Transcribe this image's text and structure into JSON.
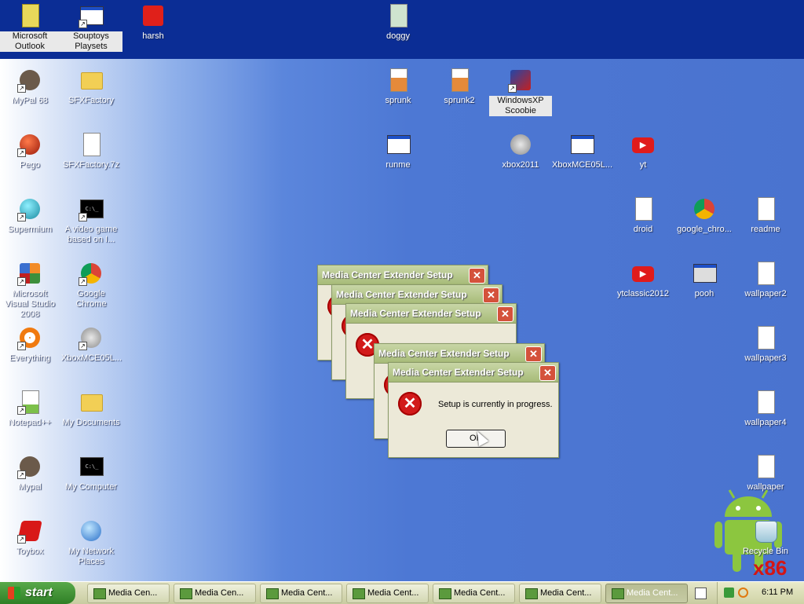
{
  "desktop_icons": [
    {
      "label": "Microsoft Outlook",
      "icon": "outlook-icon"
    },
    {
      "label": "Souptoys Playsets",
      "icon": "app-window-icon"
    },
    {
      "label": "harsh",
      "icon": "play-set-icon"
    },
    {
      "label": "doggy",
      "icon": "image-file-icon"
    },
    {
      "label": "MyPal 68",
      "icon": "raccoon-icon"
    },
    {
      "label": "SFXFactory",
      "icon": "folder-icon"
    },
    {
      "label": "sprunk",
      "icon": "archive-file-icon"
    },
    {
      "label": "sprunk2",
      "icon": "archive-file-icon"
    },
    {
      "label": "WindowsXP Scoobie",
      "icon": "installer-icon"
    },
    {
      "label": "Pego",
      "icon": "pego-icon"
    },
    {
      "label": "SFXFactory.7z",
      "icon": "7z-file-icon"
    },
    {
      "label": "runme",
      "icon": "batch-file-icon"
    },
    {
      "label": "xbox2011",
      "icon": "xbox-icon"
    },
    {
      "label": "XboxMCE05L...",
      "icon": "app-window-icon"
    },
    {
      "label": "yt",
      "icon": "youtube-icon"
    },
    {
      "label": "Supermium",
      "icon": "supermium-icon"
    },
    {
      "label": "A video game based on I...",
      "icon": "cmd-icon"
    },
    {
      "label": "droid",
      "icon": "image-file-icon"
    },
    {
      "label": "google_chro...",
      "icon": "chrome-installer-icon"
    },
    {
      "label": "readme",
      "icon": "text-file-icon"
    },
    {
      "label": "Microsoft Visual Studio 2008",
      "icon": "visual-studio-icon"
    },
    {
      "label": "Google Chrome",
      "icon": "chrome-icon"
    },
    {
      "label": "ytclassic2012",
      "icon": "youtube-icon"
    },
    {
      "label": "pooh",
      "icon": "floppy-icon"
    },
    {
      "label": "wallpaper2",
      "icon": "image-file-icon"
    },
    {
      "label": "Everything",
      "icon": "everything-icon"
    },
    {
      "label": "XboxMCE05L...",
      "icon": "xbox-icon"
    },
    {
      "label": "wallpaper3",
      "icon": "image-file-icon"
    },
    {
      "label": "Notepad++",
      "icon": "notepad-plus-icon"
    },
    {
      "label": "My Documents",
      "icon": "my-documents-icon"
    },
    {
      "label": "wallpaper4",
      "icon": "image-file-icon"
    },
    {
      "label": "Mypal",
      "icon": "raccoon-icon"
    },
    {
      "label": "My Computer",
      "icon": "cmd-icon"
    },
    {
      "label": "wallpaper",
      "icon": "image-file-icon"
    },
    {
      "label": "Toybox",
      "icon": "toybox-icon"
    },
    {
      "label": "My Network Places",
      "icon": "network-icon"
    },
    {
      "label": "Recycle Bin",
      "icon": "recycle-bin-icon"
    }
  ],
  "dialog": {
    "title": "Media Center Extender Setup",
    "message": "Setup is currently in progress.",
    "ok_label": "OK",
    "close_glyph": "✕",
    "error_glyph": "✕"
  },
  "taskbar": {
    "start_label": "start",
    "tasks": [
      {
        "label": "Media Cen...",
        "active": false
      },
      {
        "label": "Media Cen...",
        "active": false
      },
      {
        "label": "Media Cent...",
        "active": false
      },
      {
        "label": "Media Cent...",
        "active": false
      },
      {
        "label": "Media Cent...",
        "active": false
      },
      {
        "label": "Media Cent...",
        "active": false
      },
      {
        "label": "Media Cent...",
        "active": true
      }
    ],
    "clock": "6:11 PM"
  },
  "watermark": {
    "logo_text": "x86"
  }
}
